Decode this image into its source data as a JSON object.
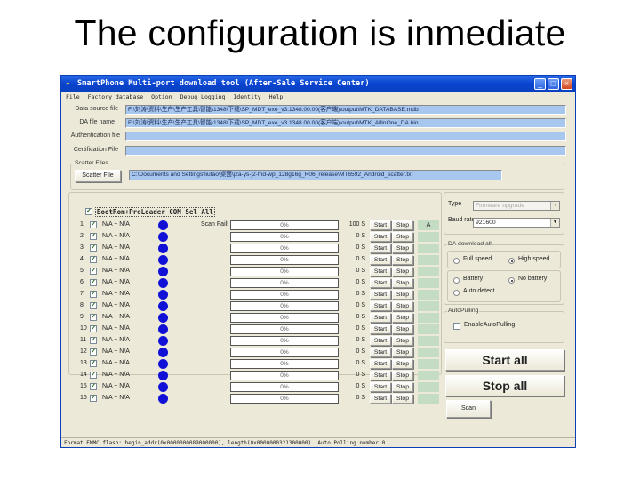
{
  "slide": {
    "title": "The configuration is inmediate"
  },
  "window": {
    "title": "SmartPhone Multi-port download tool (After-Sale Service Center)",
    "controls": {
      "minimize": "_",
      "maximize": "□",
      "close": "×"
    }
  },
  "menu": [
    "File",
    "Factory database",
    "Option",
    "Debug Logging",
    "Identity",
    "Help"
  ],
  "files": {
    "data_source_label": "Data source file",
    "data_source_value": "F:\\刘涛\\资料\\生产\\生产工具\\智能\\1348\\下载\\SP_MDT_exe_v3.1348.00.00(客户端)\\output\\MTK_DATABASE.mdb",
    "da_label": "DA file name",
    "da_value": "F:\\刘涛\\资料\\生产\\生产工具\\智能\\1348\\下载\\SP_MDT_exe_v3.1348.00.00(客户端)\\output\\MTK_AllInOne_DA.bin",
    "auth_label": "Authentication file",
    "auth_value": "",
    "cert_label": "Certification File",
    "cert_value": ""
  },
  "scatter": {
    "group_label": "Scatter Files",
    "button_label": "Scatter File",
    "value": "C:\\Documents and Settings\\liutao\\桌面\\j2a-ys-j2-fhd-wp_128g16g_R06_release\\MT6592_Android_scatter.txt"
  },
  "ports": {
    "select_all_label": "BootRom+PreLoader COM Sel All",
    "select_all_checked": true,
    "rows": [
      {
        "num": "1",
        "com": "N/A + N/A",
        "scan": "Scan Fail!",
        "progress": "0%",
        "time": "100 S",
        "status": "A",
        "checked": true
      },
      {
        "num": "2",
        "com": "N/A + N/A",
        "scan": "",
        "progress": "0%",
        "time": "0 S",
        "status": "",
        "checked": true
      },
      {
        "num": "3",
        "com": "N/A + N/A",
        "scan": "",
        "progress": "0%",
        "time": "0 S",
        "status": "",
        "checked": true
      },
      {
        "num": "4",
        "com": "N/A + N/A",
        "scan": "",
        "progress": "0%",
        "time": "0 S",
        "status": "",
        "checked": true
      },
      {
        "num": "5",
        "com": "N/A + N/A",
        "scan": "",
        "progress": "0%",
        "time": "0 S",
        "status": "",
        "checked": true
      },
      {
        "num": "6",
        "com": "N/A + N/A",
        "scan": "",
        "progress": "0%",
        "time": "0 S",
        "status": "",
        "checked": true
      },
      {
        "num": "7",
        "com": "N/A + N/A",
        "scan": "",
        "progress": "0%",
        "time": "0 S",
        "status": "",
        "checked": true
      },
      {
        "num": "8",
        "com": "N/A + N/A",
        "scan": "",
        "progress": "0%",
        "time": "0 S",
        "status": "",
        "checked": true
      },
      {
        "num": "9",
        "com": "N/A + N/A",
        "scan": "",
        "progress": "0%",
        "time": "0 S",
        "status": "",
        "checked": true
      },
      {
        "num": "10",
        "com": "N/A + N/A",
        "scan": "",
        "progress": "0%",
        "time": "0 S",
        "status": "",
        "checked": true
      },
      {
        "num": "11",
        "com": "N/A + N/A",
        "scan": "",
        "progress": "0%",
        "time": "0 S",
        "status": "",
        "checked": true
      },
      {
        "num": "12",
        "com": "N/A + N/A",
        "scan": "",
        "progress": "0%",
        "time": "0 S",
        "status": "",
        "checked": true
      },
      {
        "num": "13",
        "com": "N/A + N/A",
        "scan": "",
        "progress": "0%",
        "time": "0 S",
        "status": "",
        "checked": true
      },
      {
        "num": "14",
        "com": "N/A + N/A",
        "scan": "",
        "progress": "0%",
        "time": "0 S",
        "status": "",
        "checked": true
      },
      {
        "num": "15",
        "com": "N/A + N/A",
        "scan": "",
        "progress": "0%",
        "time": "0 S",
        "status": "",
        "checked": true
      },
      {
        "num": "16",
        "com": "N/A + N/A",
        "scan": "",
        "progress": "0%",
        "time": "0 S",
        "status": "",
        "checked": true
      }
    ],
    "start_label": "Start",
    "stop_label": "Stop",
    "led_color": "#1010d6"
  },
  "settings": {
    "type_label": "Type",
    "type_value": "Firmware upgrade",
    "baud_label": "Baud rate",
    "baud_value": "921600",
    "da_group_label": "DA download all",
    "full_speed": "Full speed",
    "high_speed": "High speed",
    "speed_selected": "High speed",
    "battery": "Battery",
    "no_battery": "No battery",
    "auto_detect": "Auto detect",
    "battery_selected": "No battery",
    "autopulling_group": "AutoPulling",
    "enable_autopulling": "EnableAutoPulling",
    "enable_autopulling_checked": false
  },
  "actions": {
    "start_all": "Start all",
    "stop_all": "Stop all",
    "scan": "Scan"
  },
  "statusbar": {
    "text": "Format EMMC flash:  begin_addr(0x0000000089000000), length(0x0000000321300000).  Auto Polling number:0"
  }
}
